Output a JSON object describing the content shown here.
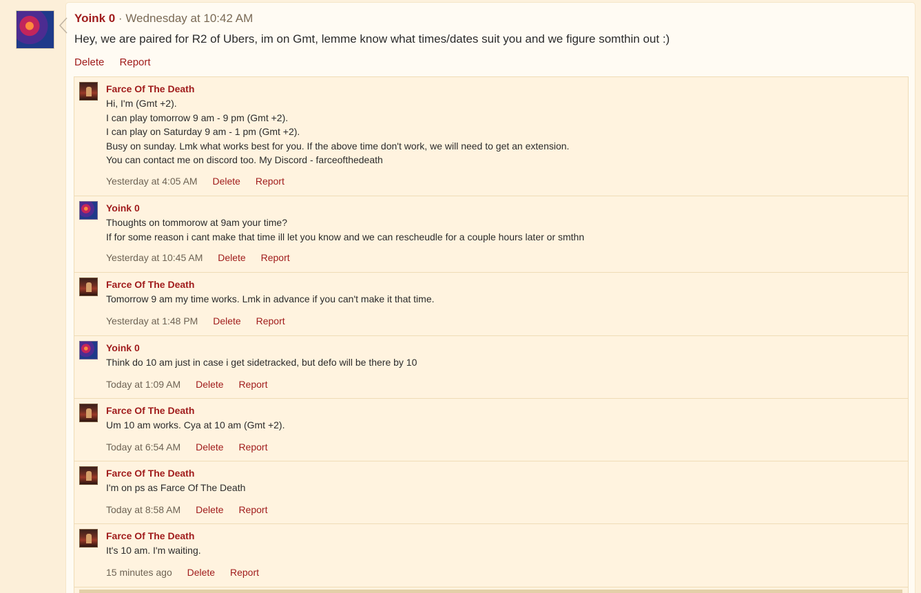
{
  "main_post": {
    "author": "Yoink 0",
    "separator": " · ",
    "timestamp": "Wednesday at 10:42 AM",
    "message": "Hey, we are paired for R2 of Ubers, im on Gmt, lemme know what times/dates suit you and we figure somthin out :)",
    "actions": {
      "delete": "Delete",
      "report": "Report"
    }
  },
  "replies": [
    {
      "author": "Farce Of The Death",
      "avatar": "farce-avatar",
      "lines": [
        "Hi, I'm (Gmt +2).",
        "I can play tomorrow 9 am - 9 pm (Gmt +2).",
        "I can play on Saturday 9 am - 1 pm (Gmt +2).",
        "Busy on sunday. Lmk what works best for you. If the above time don't work, we will need to get an extension.",
        "You can contact me on discord too. My Discord - farceofthedeath"
      ],
      "timestamp": "Yesterday at 4:05 AM",
      "delete": "Delete",
      "report": "Report"
    },
    {
      "author": "Yoink 0",
      "avatar": "yoink-avatar",
      "lines": [
        "Thoughts on tommorow at 9am your time?",
        "If for some reason i cant make that time ill let you know and we can rescheudle for a couple hours later or smthn"
      ],
      "timestamp": "Yesterday at 10:45 AM",
      "delete": "Delete",
      "report": "Report"
    },
    {
      "author": "Farce Of The Death",
      "avatar": "farce-avatar",
      "lines": [
        "Tomorrow 9 am my time works. Lmk in advance if you can't make it that time."
      ],
      "timestamp": "Yesterday at 1:48 PM",
      "delete": "Delete",
      "report": "Report"
    },
    {
      "author": "Yoink 0",
      "avatar": "yoink-avatar",
      "lines": [
        "Think do 10 am just in case i get sidetracked, but defo will be there by 10"
      ],
      "timestamp": "Today at 1:09 AM",
      "delete": "Delete",
      "report": "Report"
    },
    {
      "author": "Farce Of The Death",
      "avatar": "farce-avatar",
      "lines": [
        "Um 10 am works. Cya at 10 am (Gmt +2)."
      ],
      "timestamp": "Today at 6:54 AM",
      "delete": "Delete",
      "report": "Report"
    },
    {
      "author": "Farce Of The Death",
      "avatar": "farce-avatar",
      "lines": [
        "I'm on ps as Farce Of The Death"
      ],
      "timestamp": "Today at 8:58 AM",
      "delete": "Delete",
      "report": "Report"
    },
    {
      "author": "Farce Of The Death",
      "avatar": "farce-avatar",
      "lines": [
        "It's 10 am. I'm waiting."
      ],
      "timestamp": "15 minutes ago",
      "delete": "Delete",
      "report": "Report"
    }
  ],
  "colors": {
    "accent": "#a01c1c",
    "background": "#fdf1dc",
    "reply_background": "#fff3df",
    "border": "#efdcb6"
  }
}
